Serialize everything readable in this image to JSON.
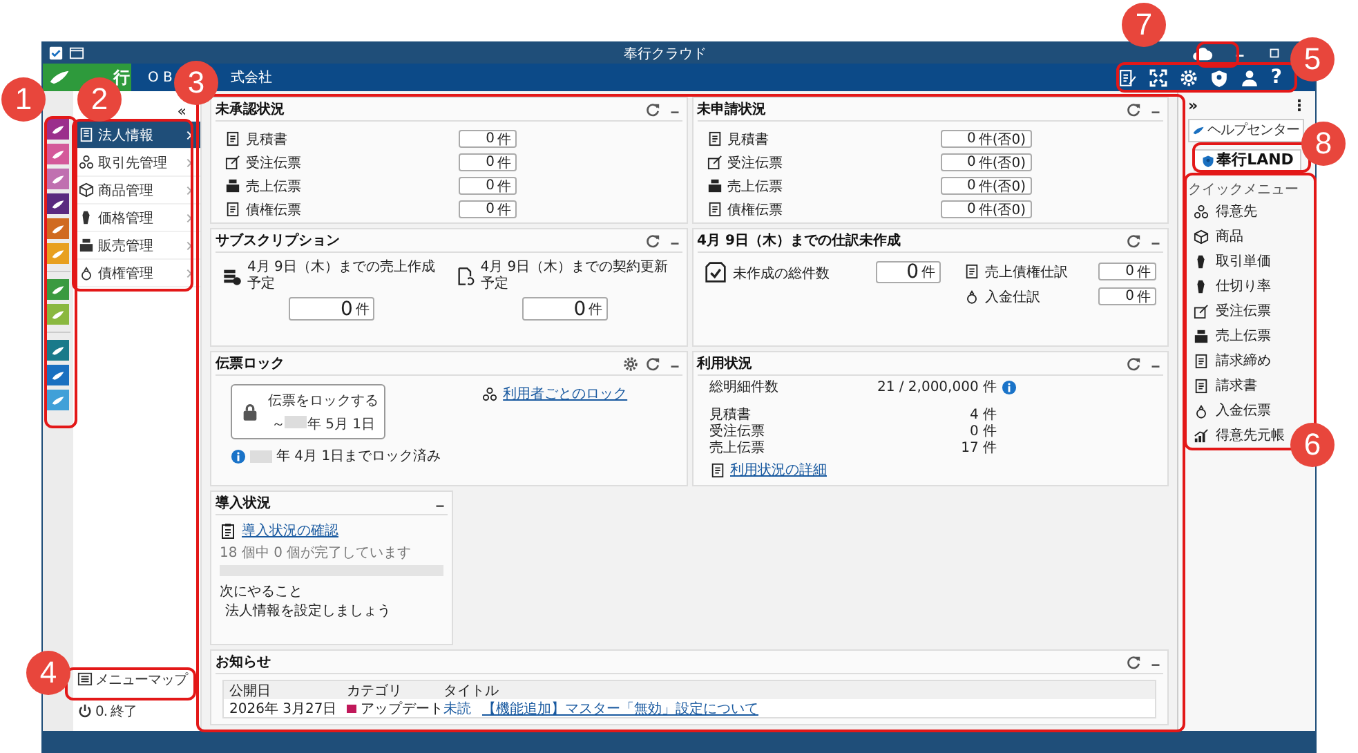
{
  "window": {
    "title": "奉行クラウド"
  },
  "header": {
    "logo": "行",
    "company_start": "O B",
    "company_end": "式会社",
    "help_glyph": "?"
  },
  "product_tiles": [
    {
      "color": "#9b2f8c"
    },
    {
      "color": "#d45a9a"
    },
    {
      "color": "#c070b0"
    },
    {
      "color": "#5a2a80"
    },
    {
      "color": "#d06a20"
    },
    {
      "color": "#e8a020"
    },
    {
      "color": "#3a9a40"
    },
    {
      "color": "#8ab840"
    },
    {
      "color": "#1a7a8a"
    },
    {
      "color": "#1a70c0"
    },
    {
      "color": "#40a0d8"
    }
  ],
  "nav": {
    "collapse": "«",
    "items": [
      {
        "label": "法人情報",
        "selected": true
      },
      {
        "label": "取引先管理",
        "selected": false
      },
      {
        "label": "商品管理",
        "selected": false
      },
      {
        "label": "価格管理",
        "selected": false
      },
      {
        "label": "販売管理",
        "selected": false
      },
      {
        "label": "債権管理",
        "selected": false
      }
    ],
    "menu_map": "メニューマップ",
    "exit": "0. 終了"
  },
  "pending_approval": {
    "title": "未承認状況",
    "rows": [
      {
        "label": "見積書",
        "value": "0",
        "unit": "件"
      },
      {
        "label": "受注伝票",
        "value": "0",
        "unit": "件"
      },
      {
        "label": "売上伝票",
        "value": "0",
        "unit": "件"
      },
      {
        "label": "債権伝票",
        "value": "0",
        "unit": "件"
      }
    ]
  },
  "pending_request": {
    "title": "未申請状況",
    "rows": [
      {
        "label": "見積書",
        "value": "0",
        "unit": "件",
        "note": "(否0)"
      },
      {
        "label": "受注伝票",
        "value": "0",
        "unit": "件",
        "note": "(否0)"
      },
      {
        "label": "売上伝票",
        "value": "0",
        "unit": "件",
        "note": "(否0)"
      },
      {
        "label": "債権伝票",
        "value": "0",
        "unit": "件",
        "note": "(否0)"
      }
    ]
  },
  "subscription": {
    "title": "サブスクリプション",
    "items": [
      {
        "label": "4月 9日（木）までの売上作成予定",
        "value": "0",
        "unit": "件"
      },
      {
        "label": "4月 9日（木）までの契約更新予定",
        "value": "0",
        "unit": "件"
      }
    ]
  },
  "journal": {
    "title": "4月 9日（木）までの仕訳未作成",
    "total": {
      "label": "未作成の総件数",
      "value": "0",
      "unit": "件"
    },
    "rows": [
      {
        "label": "売上債権仕訳",
        "value": "0",
        "unit": "件"
      },
      {
        "label": "入金仕訳",
        "value": "0",
        "unit": "件"
      }
    ]
  },
  "slip_lock": {
    "title": "伝票ロック",
    "button": "伝票をロックする",
    "lock_prefix": "～",
    "lock_date": "年 5月 1日",
    "locked_note": "年 4月 1日までロック済み",
    "link": "利用者ごとのロック"
  },
  "usage": {
    "title": "利用状況",
    "total_label": "総明細件数",
    "total_value": "21 / 2,000,000 件",
    "rows": [
      {
        "label": "見積書",
        "value": "4 件"
      },
      {
        "label": "受注伝票",
        "value": "0 件"
      },
      {
        "label": "売上伝票",
        "value": "17 件"
      }
    ],
    "link": "利用状況の詳細"
  },
  "onboarding": {
    "title": "導入状況",
    "link": "導入状況の確認",
    "progress_text": "18 個中 0 個が完了しています",
    "level": 0,
    "next_label": "次にやること",
    "next_item": "法人情報を設定しましょう"
  },
  "news": {
    "title": "お知らせ",
    "columns": [
      "公開日",
      "カテゴリ",
      "タイトル"
    ],
    "rows": [
      {
        "date": "2026年 3月27日",
        "category": "アップデート",
        "color": "#c0185a",
        "unread": "未読",
        "title": "【機能追加】マスター「無効」設定について"
      }
    ]
  },
  "right_panel": {
    "expand": "»",
    "more": "⋮",
    "help_center": "ヘルプセンター",
    "land": "奉行LAND",
    "quick_menu": {
      "title": "クイックメニュー",
      "items": [
        "得意先",
        "商品",
        "取引単価",
        "仕切り率",
        "受注伝票",
        "売上伝票",
        "請求締め",
        "請求書",
        "入金伝票",
        "得意先元帳"
      ]
    }
  },
  "callouts": [
    {
      "number": "1"
    },
    {
      "number": "2"
    },
    {
      "number": "3"
    },
    {
      "number": "4"
    },
    {
      "number": "5"
    },
    {
      "number": "6"
    },
    {
      "number": "7"
    },
    {
      "number": "8"
    }
  ]
}
